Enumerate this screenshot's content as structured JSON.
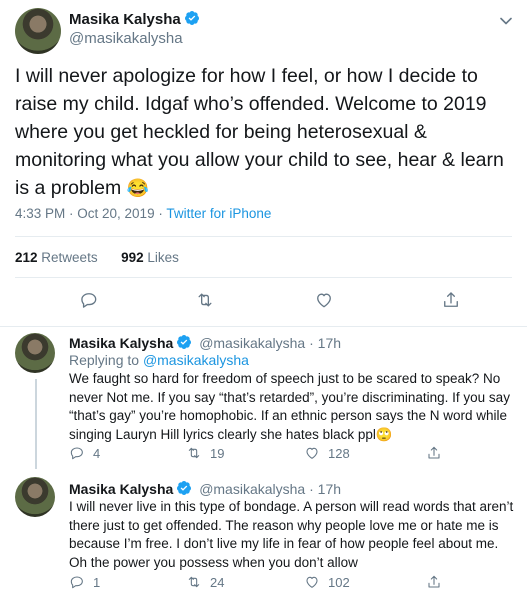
{
  "main": {
    "name": "Masika Kalysha",
    "handle": "@masikakalysha",
    "text": "I will never apologize for how I feel, or how I decide to raise my child. Idgaf who’s offended. Welcome to 2019 where you get heckled for being heterosexual & monitoring what you allow your child to see, hear & learn is a problem",
    "emoji": "😂",
    "time": "4:33 PM · Oct 20, 2019 · ",
    "source": "Twitter for iPhone",
    "retweets_count": "212",
    "retweets_label": "Retweets",
    "likes_count": "992",
    "likes_label": "Likes"
  },
  "replies": [
    {
      "name": "Masika Kalysha",
      "handle_time": "@masikakalysha · 17h",
      "replying_prefix": "Replying to",
      "replying_to": "@masikakalysha",
      "text": "We faught so hard for freedom of speech just to be scared to speak? No never Not me. If you say “that’s retarded”, you’re discriminating. If you say “that’s gay” you’re homophobic. If an ethnic person says the N word while singing  Lauryn Hill lyrics clearly she hates black ppl",
      "emoji": "🙄",
      "replies": "4",
      "retweets": "19",
      "likes": "128"
    },
    {
      "name": "Masika Kalysha",
      "handle_time": "@masikakalysha · 17h",
      "text": "I will never live in this type of bondage. A person will read words that aren’t there just to get offended. The reason why people love me or hate me is because I’m free. I don’t live my life in fear of how people feel about me. Oh the power you possess when you don’t allow",
      "replies": "1",
      "retweets": "24",
      "likes": "102"
    }
  ],
  "colors": {
    "accent": "#1b95e0",
    "muted": "#657786",
    "text": "#14171a",
    "border": "#e6ecf0"
  },
  "icons": [
    "verified-badge-icon",
    "chevron-down-icon",
    "reply-icon",
    "retweet-icon",
    "like-icon",
    "share-icon"
  ]
}
